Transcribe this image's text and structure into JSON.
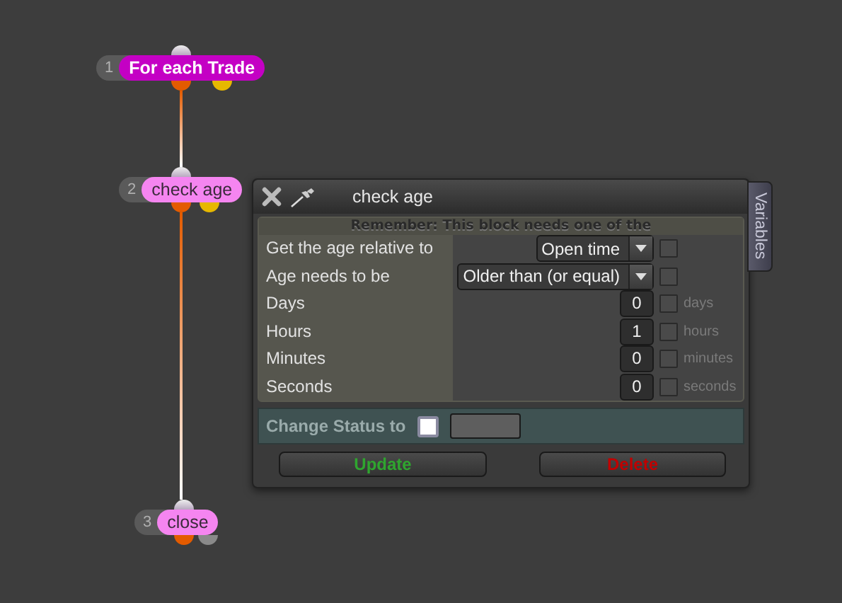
{
  "nodes": [
    {
      "number": "1",
      "label": "For each Trade",
      "kind": "loop",
      "ports": [
        {
          "color": "#e35b00"
        },
        {
          "color": "#e6b800"
        }
      ]
    },
    {
      "number": "2",
      "label": "check age",
      "kind": "action",
      "ports": [
        {
          "color": "#e35b00"
        },
        {
          "color": "#e6b800"
        }
      ]
    },
    {
      "number": "3",
      "label": "close",
      "kind": "action",
      "ports": [
        {
          "color": "#e35b00"
        },
        {
          "color": "#8a8a8a"
        }
      ]
    }
  ],
  "dialog": {
    "title": "check age",
    "side_tab": "Variables",
    "notice": "Remember: This block needs one of the",
    "fields": [
      {
        "kind": "select",
        "label": "Get the age relative to",
        "value": "Open time",
        "checked": false
      },
      {
        "kind": "select",
        "label": "Age needs to be",
        "value": "Older than (or equal)",
        "checked": false
      },
      {
        "kind": "number",
        "label": "Days",
        "value": "0",
        "unit": "days",
        "checked": false
      },
      {
        "kind": "number",
        "label": "Hours",
        "value": "1",
        "unit": "hours",
        "checked": false
      },
      {
        "kind": "number",
        "label": "Minutes",
        "value": "0",
        "unit": "minutes",
        "checked": false
      },
      {
        "kind": "number",
        "label": "Seconds",
        "value": "0",
        "unit": "seconds",
        "checked": false
      }
    ],
    "status": {
      "label": "Change Status to",
      "checked": false
    },
    "buttons": [
      {
        "label": "Update",
        "kind": "update"
      },
      {
        "label": "Delete",
        "kind": "delete"
      }
    ]
  }
}
